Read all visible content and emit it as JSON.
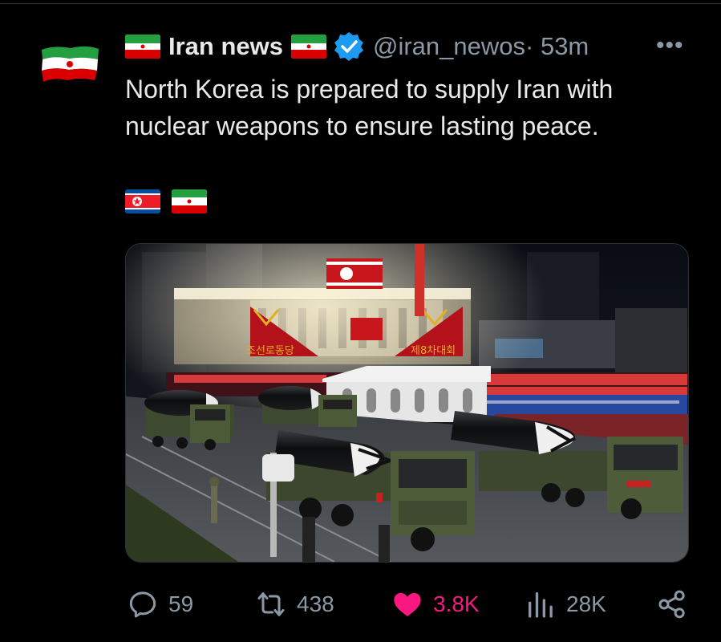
{
  "tweet": {
    "display_name": "Iran news",
    "handle": "@iran_newos",
    "time": " · 53m",
    "text": "North Korea is prepared to supply Iran with nuclear weapons to ensure lasting peace.",
    "more_label": "•••"
  },
  "media": {
    "banner_left": "조선로동당",
    "banner_right": "제8차대회"
  },
  "actions": {
    "replies": "59",
    "retweets": "438",
    "likes": "3.8K",
    "views": "28K"
  },
  "colors": {
    "background": "#000000",
    "text": "#e7e9ea",
    "muted": "#8b98a5",
    "verified": "#1d9bf0",
    "like": "#f91880"
  },
  "icons": [
    "iran-flag-icon",
    "verified-badge-icon",
    "more-icon",
    "north-korea-flag-icon",
    "reply-icon",
    "retweet-icon",
    "heart-icon",
    "views-icon",
    "share-icon"
  ]
}
